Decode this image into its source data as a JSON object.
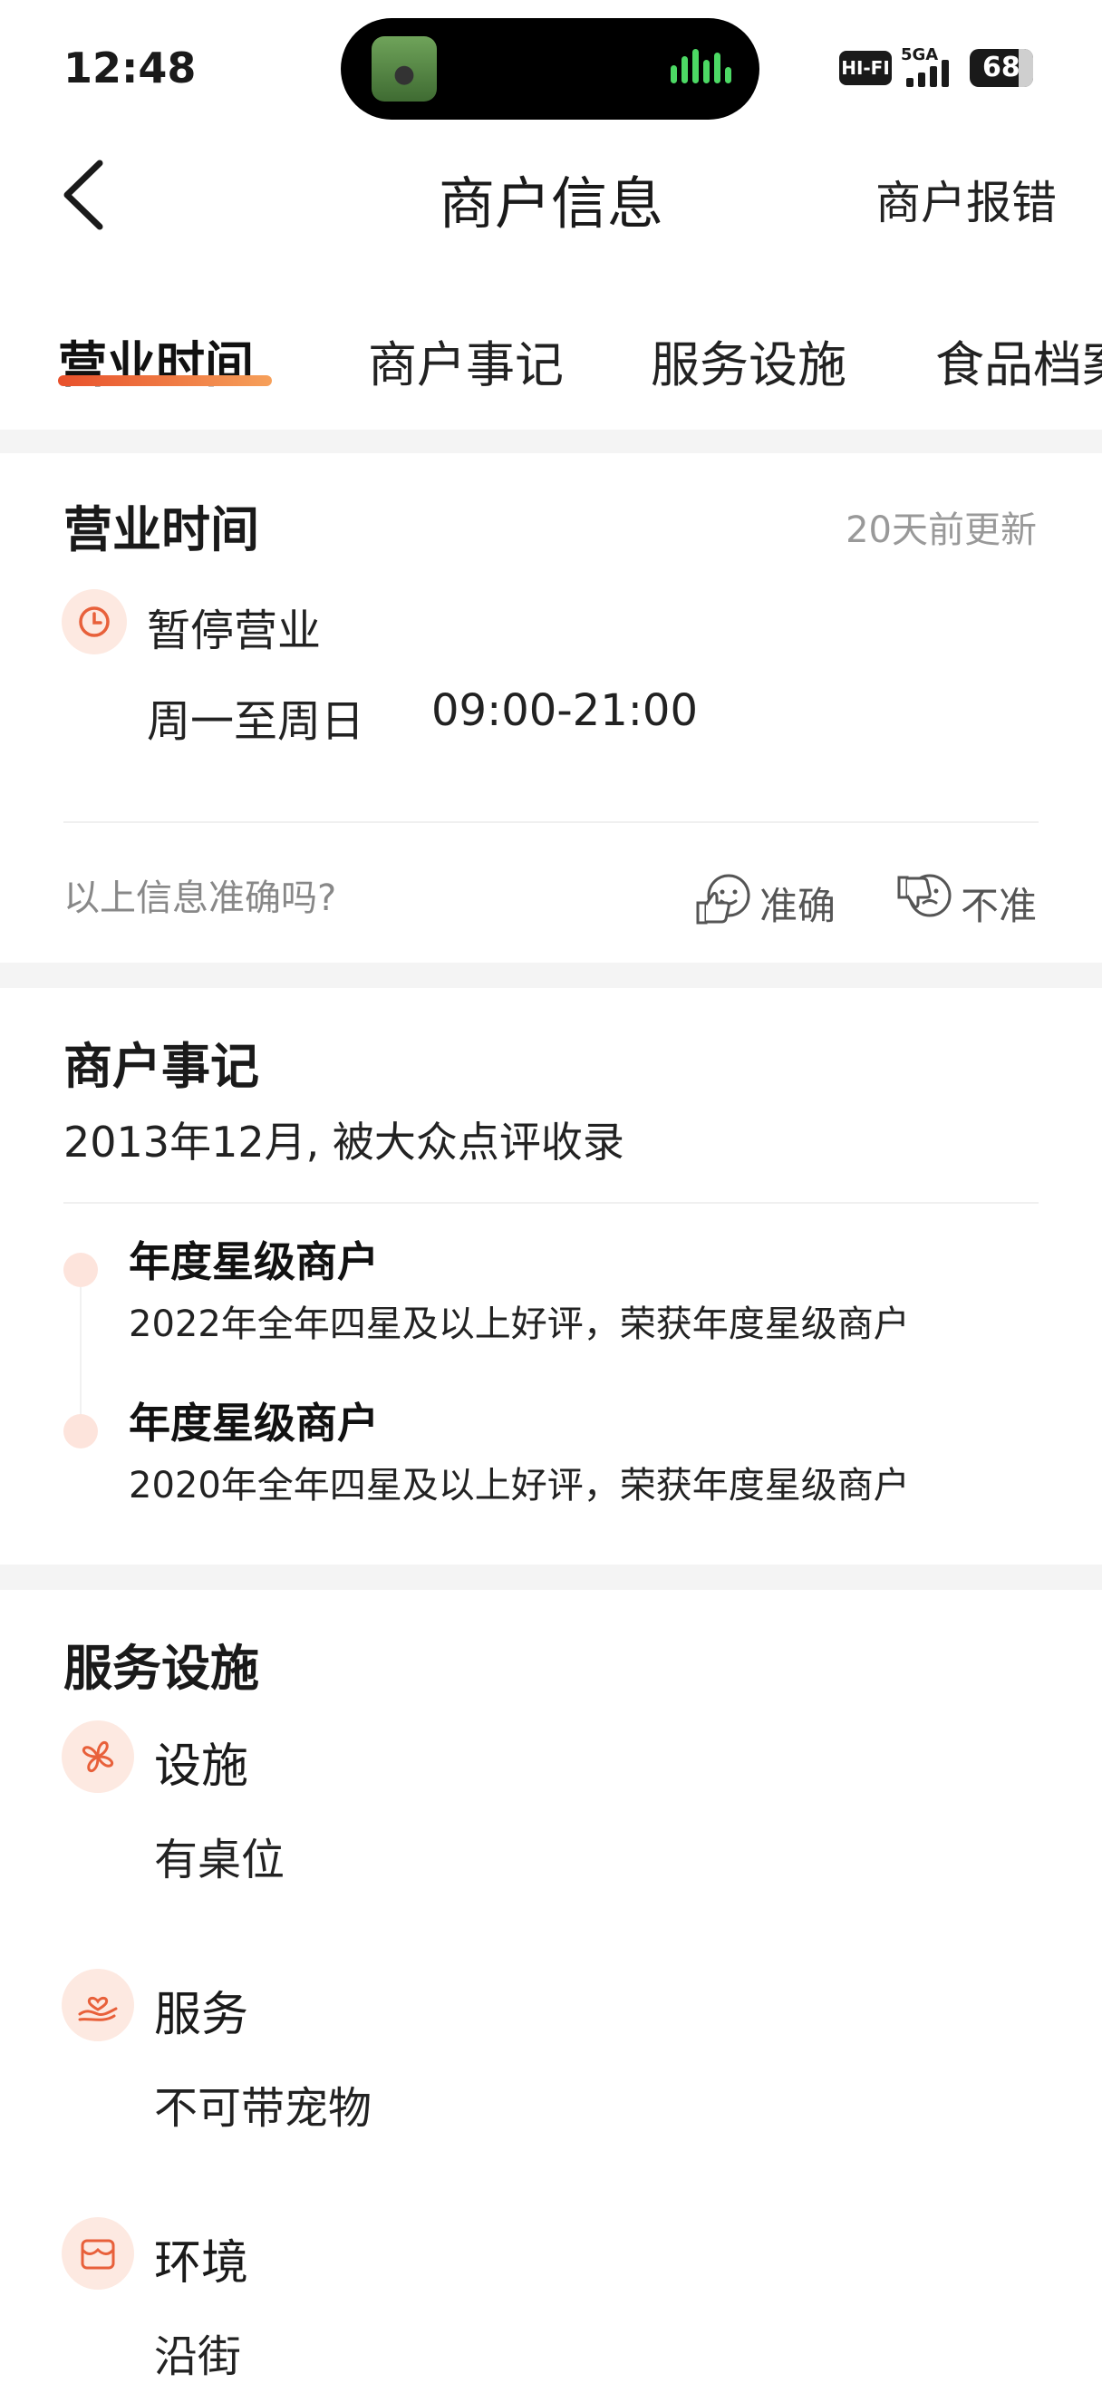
{
  "status_bar": {
    "time": "12:48",
    "hifi": "HI-FI",
    "network": "5GA",
    "battery": "68"
  },
  "nav": {
    "title": "商户信息",
    "action": "商户报错"
  },
  "tabs": [
    {
      "label": "营业时间",
      "active": true
    },
    {
      "label": "商户事记",
      "active": false
    },
    {
      "label": "服务设施",
      "active": false
    },
    {
      "label": "食品档案",
      "active": false
    }
  ],
  "hours": {
    "title": "营业时间",
    "updated": "20天前更新",
    "status": "暂停营业",
    "days": "周一至周日",
    "time_range": "09:00-21:00",
    "question": "以上信息准确吗?",
    "accurate_label": "准确",
    "inaccurate_label": "不准"
  },
  "history": {
    "title": "商户事记",
    "subtitle": "2013年12月, 被大众点评收录",
    "items": [
      {
        "title": "年度星级商户",
        "desc": "2022年全年四星及以上好评，荣获年度星级商户"
      },
      {
        "title": "年度星级商户",
        "desc": "2020年全年四星及以上好评，荣获年度星级商户"
      }
    ]
  },
  "facilities": {
    "title": "服务设施",
    "groups": [
      {
        "label": "设施",
        "value": "有桌位",
        "icon": "facility-icon"
      },
      {
        "label": "服务",
        "value": "不可带宠物",
        "icon": "service-hand-heart-icon"
      },
      {
        "label": "环境",
        "value": "沿街",
        "icon": "storefront-icon"
      }
    ]
  },
  "colors": {
    "accent": "#e8502b",
    "accent_soft": "#fde9e1",
    "muted_text": "#999999"
  }
}
